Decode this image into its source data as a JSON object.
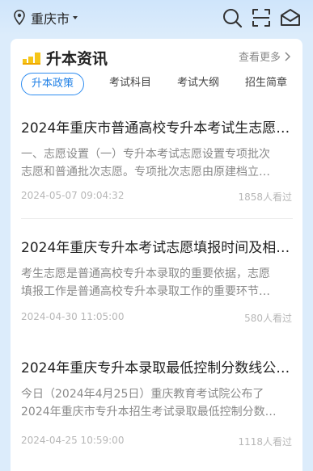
{
  "header": {
    "city": "重庆市",
    "icons": [
      "location-pin-icon",
      "search-icon",
      "scan-icon",
      "message-icon"
    ]
  },
  "section": {
    "title": "升本资讯",
    "more": "查看更多"
  },
  "tabs": [
    {
      "label": "升本政策",
      "active": true
    },
    {
      "label": "考试科目",
      "active": false
    },
    {
      "label": "考试大纲",
      "active": false
    },
    {
      "label": "招生简章",
      "active": false
    }
  ],
  "news": [
    {
      "title": "2024年重庆市普通高校专升本考试生志愿…",
      "summary": [
        "一、志愿设置（一）专升本考试志愿设置专项批次",
        "志愿和普通批次志愿。专项批次志愿由原建档立…"
      ],
      "date": "2024-05-07 09:04:32",
      "views": "1858人看过"
    },
    {
      "title": "2024年重庆专升本考试志愿填报时间及相…",
      "summary": [
        "考生志愿是普通高校专升本录取的重要依据，志愿",
        "填报工作是普通高校专升本录取工作的重要环节…"
      ],
      "date": "2024-04-30 11:05:00",
      "views": "580人看过"
    },
    {
      "title": "2024年重庆专升本录取最低控制分数线公…",
      "summary": [
        "今日（2024年4月25日）重庆教育考试院公布了",
        "2024年重庆市专升本招生考试录取最低控制分数…"
      ],
      "date": "2024-04-25 10:59:00",
      "views": "1118人看过"
    }
  ],
  "colors": {
    "accent": "#2e8cf0",
    "title_bar_yellow": "#f5c518",
    "background": "#dcecfb"
  }
}
